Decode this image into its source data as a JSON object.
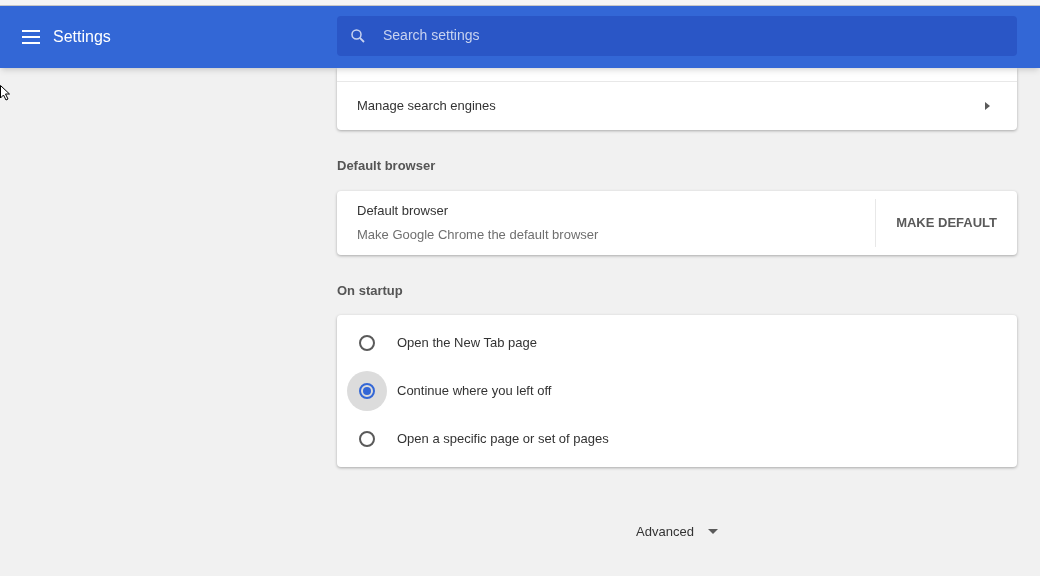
{
  "header": {
    "title": "Settings",
    "search": {
      "placeholder": "Search settings"
    }
  },
  "search_engine_card": {
    "label": "Manage search engines"
  },
  "default_browser": {
    "heading": "Default browser",
    "title": "Default browser",
    "subtitle": "Make Google Chrome the default browser",
    "button": "MAKE DEFAULT"
  },
  "on_startup": {
    "heading": "On startup",
    "options": [
      {
        "label": "Open the New Tab page",
        "selected": false
      },
      {
        "label": "Continue where you left off",
        "selected": true
      },
      {
        "label": "Open a specific page or set of pages",
        "selected": false
      }
    ]
  },
  "advanced": {
    "label": "Advanced",
    "expanded": false
  }
}
